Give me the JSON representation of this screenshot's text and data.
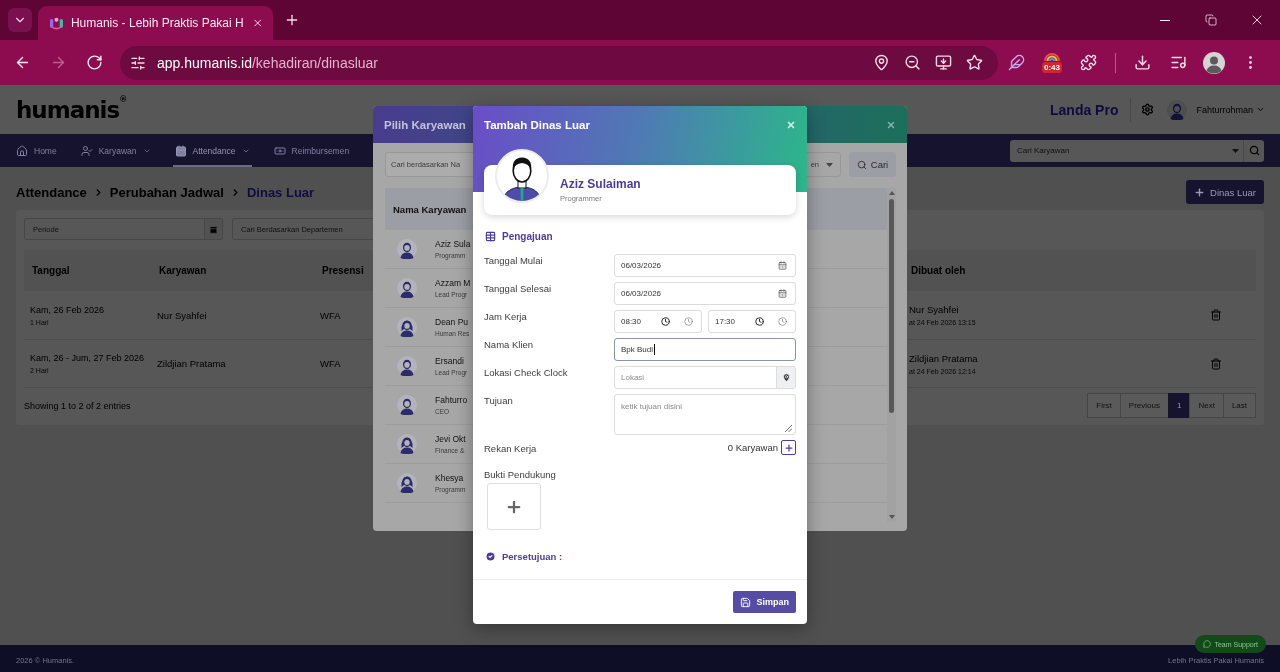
{
  "browser": {
    "tabs": [
      {
        "title": "Humanis - Lebih Praktis Pakai H",
        "selected": true
      }
    ],
    "nav_buttons": [
      {
        "kind": "back",
        "disabled": false
      },
      {
        "kind": "forward",
        "disabled": true
      },
      {
        "kind": "reload",
        "disabled": false
      }
    ],
    "url": {
      "host": "app.humanis.id",
      "path": "/kehadiran/dinasluar"
    },
    "extension_badge": "0:43"
  },
  "header": {
    "logo": "humanis$^{®}$",
    "company": "Landa Pro",
    "user": "Fahturrohman"
  },
  "nav": {
    "items": [
      {
        "label": "Home",
        "kind": "home",
        "dropdown": false,
        "selected": false
      },
      {
        "label": "Karyawan",
        "kind": "people",
        "dropdown": true,
        "selected": false
      },
      {
        "label": "Attendance",
        "kind": "calendar",
        "dropdown": true,
        "selected": true
      },
      {
        "label": "Reimbursemen",
        "kind": "money",
        "dropdown": false,
        "selected": false
      }
    ],
    "search": {
      "placeholder": "Cari Karyawan"
    }
  },
  "breadcrumb": [
    {
      "label": "Attendance",
      "current": false
    },
    {
      "label": "Perubahan Jadwal",
      "current": false
    },
    {
      "label": "Dinas Luar",
      "current": true
    }
  ],
  "add_button": "Dinas Luar",
  "filters": {
    "period": {
      "placeholder": "Periode"
    },
    "department": {
      "placeholder": "Cari Berdasarkan Departemen"
    }
  },
  "table": {
    "columns": [
      "Tanggal",
      "Karyawan",
      "Presensi",
      "Dibuat oleh"
    ],
    "rows": [
      {
        "date": "Kam, 26 Feb 2026",
        "duration": "1 Hari",
        "employee": "Nur Syahfei",
        "presence": "WFA",
        "created_by": "Nur Syahfei",
        "created_at": "at 24 Feb 2026 13:15"
      },
      {
        "date": "Kam, 26 - Jum, 27 Feb 2026",
        "duration": "2 Hari",
        "employee": "Zildjian Pratama",
        "presence": "WFA",
        "created_by": "Zildjian Pratama",
        "created_at": "at 24 Feb 2026 12:14"
      }
    ]
  },
  "entries_info": "Showing 1 to 2 of 2 entries",
  "pagination": [
    {
      "label": "First",
      "selected": false
    },
    {
      "label": "Previous",
      "selected": false
    },
    {
      "label": "1",
      "selected": true
    },
    {
      "label": "Next",
      "selected": false
    },
    {
      "label": "Last",
      "selected": false
    }
  ],
  "footer": {
    "copyright": "2026 © Humanis.",
    "tagline": "Lebih Praktis Pakai Humanis",
    "support_button": "Team Support"
  },
  "employee_picker": {
    "title": "Pilih Karyawan",
    "search": {
      "placeholder": "Cari berdasarkan Na"
    },
    "department_select": {
      "placeholder": "en"
    },
    "search_button": "Cari",
    "column": "Nama Karyawan",
    "employees": [
      {
        "name": "Aziz Sula",
        "position": "Programm",
        "kind": "male"
      },
      {
        "name": "Azzam M",
        "position": "Lead Progr",
        "kind": "male"
      },
      {
        "name": "Dean Pu",
        "position": "Human Res",
        "kind": "female"
      },
      {
        "name": "Ersandi",
        "position": "Lead Progr",
        "kind": "male"
      },
      {
        "name": "Fahturro",
        "position": "CEO",
        "kind": "male"
      },
      {
        "name": "Jevi Okt",
        "position": "Finance &",
        "kind": "female"
      },
      {
        "name": "Khesya",
        "position": "Programm",
        "kind": "female"
      }
    ]
  },
  "dialog": {
    "title": "Tambah Dinas Luar",
    "employee": {
      "name": "Aziz Sulaiman",
      "position": "Programmer"
    },
    "section": "Pengajuan",
    "fields": [
      {
        "label": "Tanggal Mulai",
        "kind": "date",
        "value": "06/03/2026",
        "focused": false
      },
      {
        "label": "Tanggal Selesai",
        "kind": "date",
        "value": "06/03/2026",
        "focused": false
      },
      {
        "label": "Jam Kerja",
        "kind": "time_range",
        "start": "08:30",
        "end": "17:30",
        "focused": false
      },
      {
        "label": "Nama Klien",
        "kind": "text",
        "value": "Bpk Budi",
        "focused": true
      },
      {
        "label": "Lokasi Check Clock",
        "kind": "location",
        "placeholder": "Lokasi",
        "focused": false
      },
      {
        "label": "Tujuan",
        "kind": "textarea",
        "placeholder": "ketik tujuan disini",
        "focused": false
      },
      {
        "label": "Rekan Kerja",
        "kind": "count",
        "value": "0 Karyawan",
        "focused": false
      },
      {
        "label": "Bukti Pendukung",
        "kind": "upload",
        "focused": false
      }
    ],
    "approval": "Persetujuan :",
    "save_button": "Simpan"
  }
}
